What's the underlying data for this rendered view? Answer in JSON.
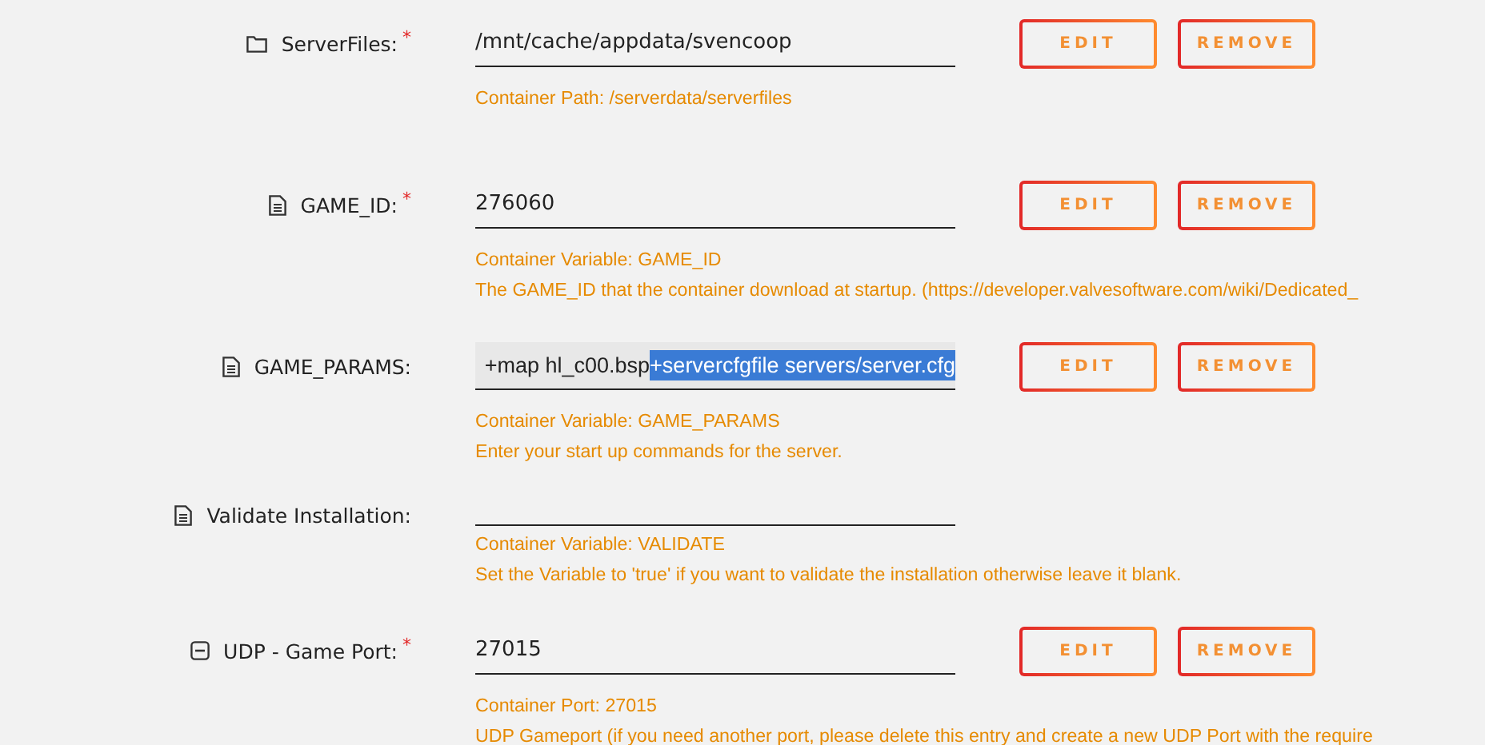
{
  "settings": [
    {
      "kind": "folder",
      "label": "ServerFiles:",
      "required_mark": "*",
      "value": "/mnt/cache/appdata/svencoop",
      "buttons": [
        "EDIT",
        "REMOVE"
      ],
      "description": [
        "Container Path: /serverdata/serverfiles"
      ]
    },
    {
      "kind": "file",
      "label": "GAME_ID:",
      "required_mark": "*",
      "value": "276060",
      "buttons": [
        "EDIT",
        "REMOVE"
      ],
      "description": [
        "Container Variable: GAME_ID",
        "The GAME_ID that the container download at startup. (https://developer.valvesoftware.com/wiki/Dedicated_"
      ]
    },
    {
      "kind": "file",
      "label": "GAME_PARAMS:",
      "value": "+map hl_c00.bsp ",
      "selected_value": "+servercfgfile servers/server.cfg",
      "focused": true,
      "buttons": [
        "EDIT",
        "REMOVE"
      ],
      "description": [
        "Container Variable: GAME_PARAMS",
        "Enter your start up commands for the server."
      ]
    },
    {
      "kind": "file",
      "label": "Validate Installation:",
      "description": [
        "Container Variable: VALIDATE",
        "Set the Variable to 'true' if you want to validate the installation otherwise leave it blank."
      ]
    },
    {
      "kind": "port",
      "label": "UDP - Game Port:",
      "required_mark": "*",
      "value": "27015",
      "buttons": [
        "EDIT",
        "REMOVE"
      ],
      "description": [
        "Container Port: 27015",
        "UDP Gameport (if you need another port, please delete this entry and create a new UDP Port with the require"
      ]
    }
  ]
}
